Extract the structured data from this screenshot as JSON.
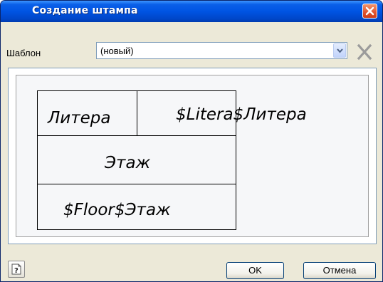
{
  "window": {
    "title": "Создание штампа",
    "close_icon": "close-icon"
  },
  "template_row": {
    "label": "Шаблон",
    "selected_value": "(новый)",
    "dropdown_icon": "chevron-down-icon",
    "clear_icon": "clear-x-icon"
  },
  "stamp_preview": {
    "cells": {
      "literal_label": "Литера",
      "literal_value": "$Litera$Литера",
      "floor_label": "Этаж",
      "floor_value": "$Floor$Этаж"
    }
  },
  "footer": {
    "help_icon": "help-icon",
    "ok_label": "OK",
    "cancel_label": "Отмена"
  },
  "colors": {
    "titlebar": "#0054e3",
    "close_button": "#e2532e",
    "dialog_background": "#ece9d8",
    "canvas_background": "#f6f7f9"
  }
}
